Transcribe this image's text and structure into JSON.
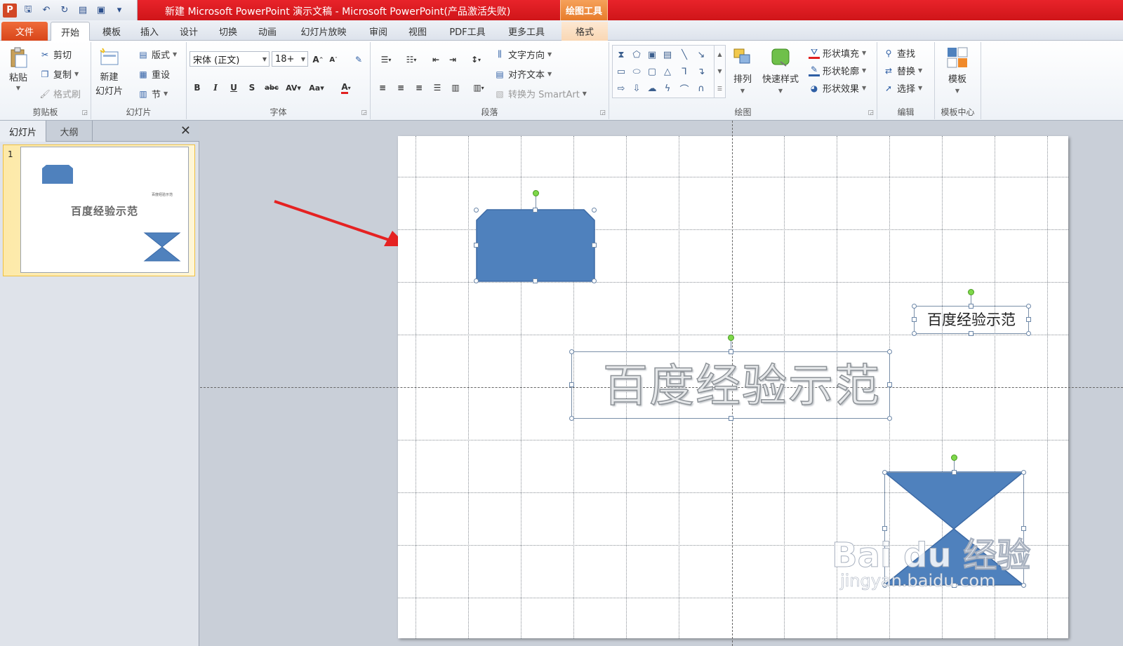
{
  "title_bar": {
    "window_title": "新建 Microsoft PowerPoint 演示文稿 - Microsoft PowerPoint(产品激活失败)",
    "contextual_tool": "绘图工具",
    "app_icon": "P"
  },
  "tabs": [
    "文件",
    "开始",
    "模板",
    "插入",
    "设计",
    "切换",
    "动画",
    "幻灯片放映",
    "审阅",
    "视图",
    "PDF工具",
    "更多工具",
    "格式"
  ],
  "ribbon": {
    "clipboard": {
      "label": "剪贴板",
      "paste": "粘贴",
      "cut": "剪切",
      "copy": "复制",
      "format_painter": "格式刷"
    },
    "slides": {
      "label": "幻灯片",
      "new_slide_1": "新建",
      "new_slide_2": "幻灯片",
      "layout": "版式",
      "reset": "重设",
      "section": "节"
    },
    "font": {
      "label": "字体",
      "font_name": "宋体 (正文)",
      "font_size": "18+"
    },
    "paragraph": {
      "label": "段落",
      "text_direction": "文字方向",
      "align_text": "对齐文本",
      "convert_smartart": "转换为 SmartArt"
    },
    "drawing": {
      "label": "绘图",
      "arrange": "排列",
      "quick_styles": "快速样式",
      "shape_fill": "形状填充",
      "shape_outline": "形状轮廓",
      "shape_effects": "形状效果"
    },
    "editing": {
      "label": "编辑",
      "find": "查找",
      "replace": "替换",
      "select": "选择"
    },
    "template": {
      "label": "模板中心",
      "template": "模板"
    }
  },
  "left_pane": {
    "tab_slides": "幻灯片",
    "tab_outline": "大纲",
    "slide_number": "1",
    "thumb_title": "百度经验示范",
    "thumb_small": "百度经验示范"
  },
  "slide": {
    "title_text": "百度经验示范",
    "small_text": "百度经验示范",
    "shape_color": "#4f81bd"
  },
  "watermark": {
    "brand": "Bai du 经验",
    "url": "jingyan.baidu.com"
  },
  "colors": {
    "title_bar": "#d9191e",
    "file_tab": "#d8461a",
    "contextual_tab": "#e77c2b",
    "annotation_arrow": "#e52222"
  }
}
